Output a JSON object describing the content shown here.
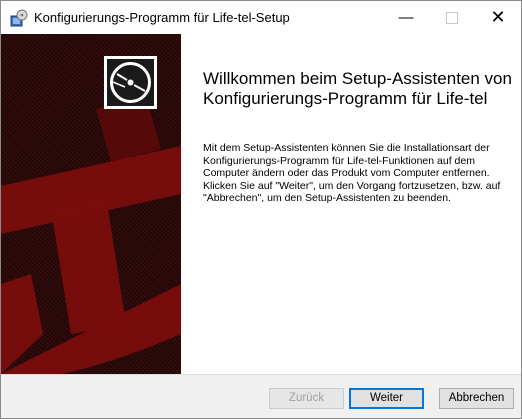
{
  "window": {
    "title": "Konfigurierungs-Programm für Life-tel-Setup",
    "minimize_glyph": "—",
    "close_glyph": "✕"
  },
  "colors": {
    "banner_dark": "#2a0606",
    "banner_red": "#7a0d0d",
    "accent_focus": "#0078d7"
  },
  "banner": {
    "logo_icon": "disc-install-icon",
    "art": "anchor-shape"
  },
  "content": {
    "heading": "Willkommen beim Setup-Assistenten von Konfigurierungs-Programm für Life-tel",
    "body": "Mit dem Setup-Assistenten können Sie die Installationsart der Konfigurierungs-Programm für Life-tel-Funktionen auf dem Computer ändern oder das Produkt vom Computer entfernen. Klicken Sie auf \"Weiter\", um den Vorgang fortzusetzen, bzw. auf \"Abbrechen\", um den Setup-Assistenten zu beenden."
  },
  "buttons": {
    "back_label": "Zurück",
    "next_label": "Weiter",
    "cancel_label": "Abbrechen"
  }
}
